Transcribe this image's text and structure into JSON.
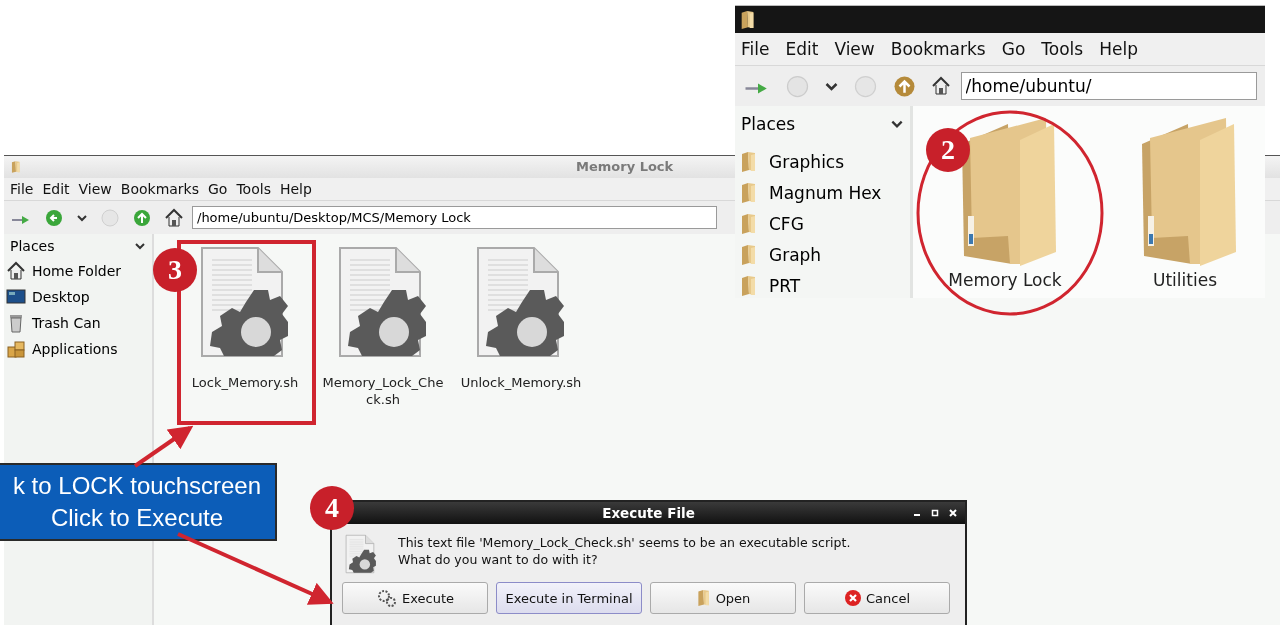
{
  "file_window": {
    "title": "Memory Lock",
    "menu": [
      "File",
      "Edit",
      "View",
      "Bookmarks",
      "Go",
      "Tools",
      "Help"
    ],
    "address": "/home/ubuntu/Desktop/MCS/Memory Lock",
    "places_header": "Places",
    "places": [
      {
        "label": "Home Folder",
        "kind": "home"
      },
      {
        "label": "Desktop",
        "kind": "desktop"
      },
      {
        "label": "Trash Can",
        "kind": "trash"
      },
      {
        "label": "Applications",
        "kind": "applications"
      }
    ],
    "files": [
      {
        "name": "Lock_Memory.sh"
      },
      {
        "name": "Memory_Lock_Che ck.sh"
      },
      {
        "name": "Unlock_Memory.sh"
      }
    ]
  },
  "folder_window": {
    "menu": [
      "File",
      "Edit",
      "View",
      "Bookmarks",
      "Go",
      "Tools",
      "Help"
    ],
    "address": "/home/ubuntu/",
    "places_header": "Places",
    "places": [
      {
        "label": "Graphics",
        "kind": "folder"
      },
      {
        "label": "Magnum Hex",
        "kind": "folder"
      },
      {
        "label": "CFG",
        "kind": "folder"
      },
      {
        "label": "Graph",
        "kind": "folder"
      },
      {
        "label": "PRT",
        "kind": "folder"
      }
    ],
    "folders": [
      {
        "name": "Memory Lock"
      },
      {
        "name": "Utilities"
      }
    ]
  },
  "dialog": {
    "title": "Execute File",
    "message_lines": [
      "This text file 'Memory_Lock_Check.sh' seems to be an executable script.",
      "What do you want to do with it?"
    ],
    "buttons": [
      {
        "label": "Execute",
        "kind": "execute",
        "focused": false
      },
      {
        "label": "Execute in Terminal",
        "kind": "terminal",
        "focused": true
      },
      {
        "label": "Open",
        "kind": "open",
        "focused": false
      },
      {
        "label": "Cancel",
        "kind": "cancel",
        "focused": false
      }
    ]
  },
  "callout": {
    "lines": [
      "k to LOCK touchscreen",
      "Click to Execute"
    ]
  },
  "step_markers": [
    {
      "number": "2"
    },
    {
      "number": "3"
    },
    {
      "number": "4"
    }
  ]
}
